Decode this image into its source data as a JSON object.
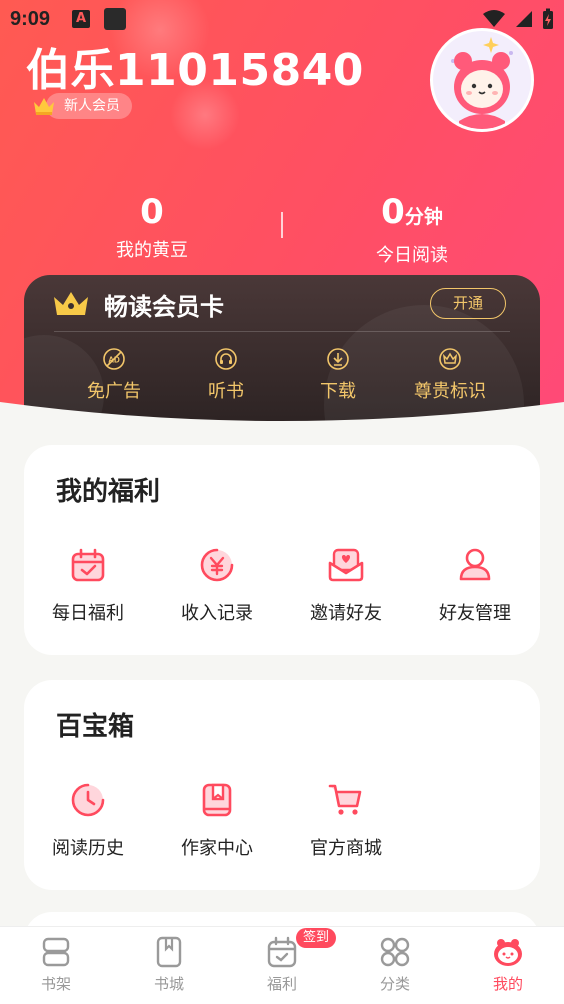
{
  "status_bar": {
    "time": "9:09",
    "notif_letter": "A"
  },
  "profile": {
    "username": "伯乐11015840",
    "member_badge": "新人会员"
  },
  "stats": {
    "beans_value": "0",
    "beans_label": "我的黄豆",
    "reading_value": "0",
    "reading_unit": "分钟",
    "reading_label": "今日阅读"
  },
  "vip_card": {
    "title": "畅读会员卡",
    "open_button": "开通",
    "benefits": [
      {
        "label": "免广告",
        "icon": "no-ad-icon"
      },
      {
        "label": "听书",
        "icon": "headphones-icon"
      },
      {
        "label": "下载",
        "icon": "download-icon"
      },
      {
        "label": "尊贵标识",
        "icon": "crown-icon"
      }
    ]
  },
  "welfare": {
    "title": "我的福利",
    "items": [
      {
        "label": "每日福利",
        "icon": "calendar-check-icon"
      },
      {
        "label": "收入记录",
        "icon": "yuan-coin-icon"
      },
      {
        "label": "邀请好友",
        "icon": "envelope-heart-icon"
      },
      {
        "label": "好友管理",
        "icon": "user-icon"
      }
    ]
  },
  "toolbox": {
    "title": "百宝箱",
    "items": [
      {
        "label": "阅读历史",
        "icon": "clock-icon"
      },
      {
        "label": "作家中心",
        "icon": "book-bookmark-icon"
      },
      {
        "label": "官方商城",
        "icon": "cart-icon"
      }
    ]
  },
  "tabbar": {
    "items": [
      {
        "label": "书架",
        "icon": "bookshelf-icon"
      },
      {
        "label": "书城",
        "icon": "book-icon"
      },
      {
        "label": "福利",
        "icon": "calendar-icon"
      },
      {
        "label": "分类",
        "icon": "grid-icon"
      },
      {
        "label": "我的",
        "icon": "mascot-icon"
      }
    ],
    "active_index": 4,
    "welfare_badge": "签到"
  },
  "colors": {
    "brand": "#ff4a5e",
    "gold": "#f2c66a",
    "header_gradient_start": "#ff5a52",
    "header_gradient_end": "#ff4a78"
  }
}
